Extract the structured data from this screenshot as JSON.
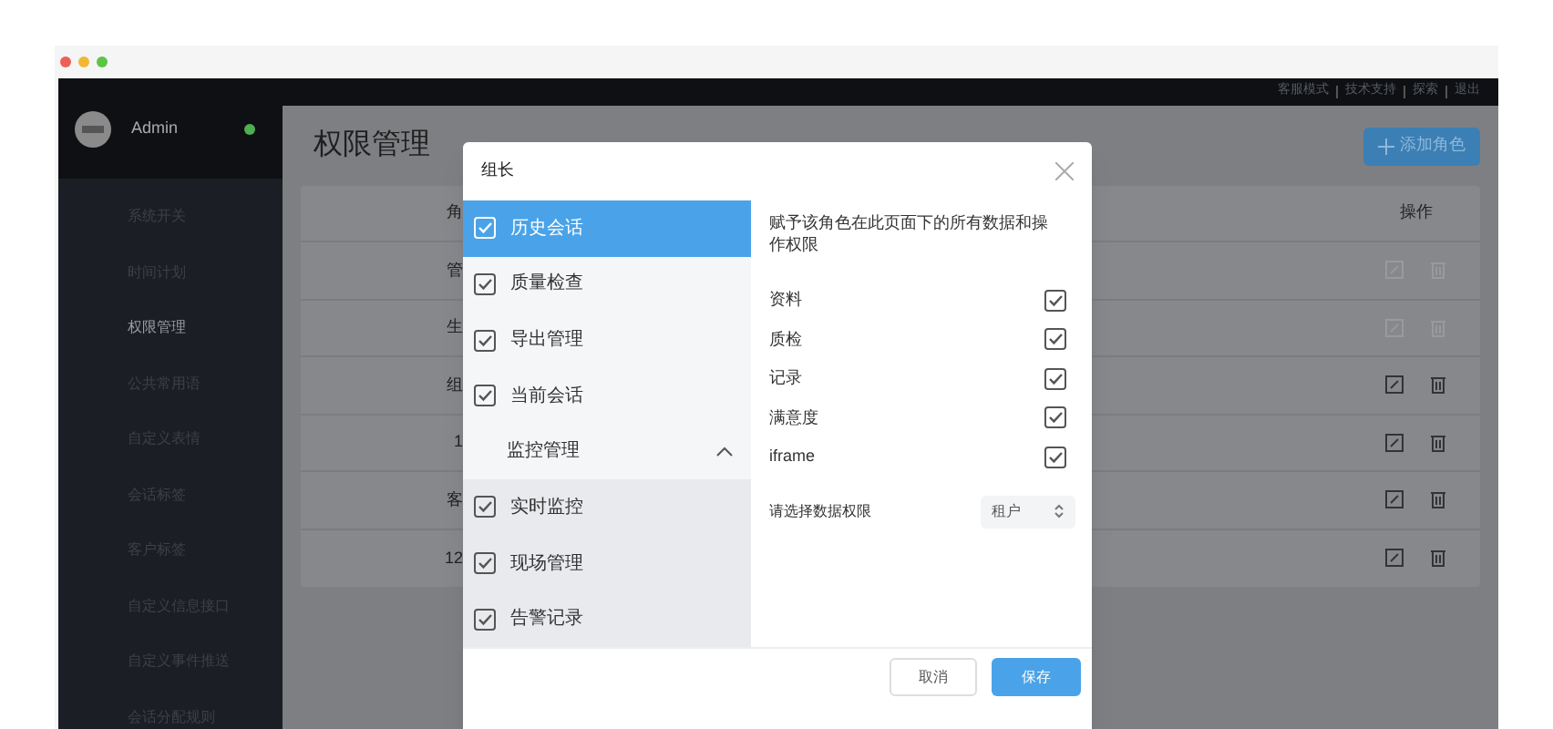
{
  "user": {
    "name": "Admin",
    "online": true
  },
  "top_links": [
    "客服模式",
    "技术支持",
    "探索",
    "退出"
  ],
  "sidebar": {
    "items": [
      {
        "label": "系统开关",
        "selected": false
      },
      {
        "label": "时间计划",
        "selected": false
      },
      {
        "label": "权限管理",
        "selected": true
      },
      {
        "label": "公共常用语",
        "selected": false
      },
      {
        "label": "自定义表情",
        "selected": false
      },
      {
        "label": "会话标签",
        "selected": false
      },
      {
        "label": "客户标签",
        "selected": false
      },
      {
        "label": "自定义信息接口",
        "selected": false
      },
      {
        "label": "自定义事件推送",
        "selected": false
      },
      {
        "label": "会话分配规则",
        "selected": false
      }
    ]
  },
  "page": {
    "title": "权限管理",
    "add_button": "添加角色"
  },
  "table": {
    "column_1": "角",
    "actions_header": "操作",
    "rows": [
      {
        "column_1": "管",
        "disabled": true
      },
      {
        "column_1": "生",
        "disabled": true
      },
      {
        "column_1": "组",
        "disabled": false
      },
      {
        "column_1": "1",
        "disabled": false
      },
      {
        "column_1": "客",
        "disabled": false
      },
      {
        "column_1": "12",
        "disabled": false
      }
    ]
  },
  "dialog": {
    "title": "组长",
    "pages": [
      {
        "kind": "item",
        "label": "历史会话",
        "checked": true,
        "selected": true
      },
      {
        "kind": "item",
        "label": "质量检查",
        "checked": true,
        "selected": false
      },
      {
        "kind": "item",
        "label": "导出管理",
        "checked": true,
        "selected": false
      },
      {
        "kind": "item",
        "label": "当前会话",
        "checked": true,
        "selected": false
      },
      {
        "kind": "group",
        "label": "监控管理",
        "expanded": true,
        "children": [
          {
            "kind": "item",
            "label": "实时监控",
            "checked": true,
            "selected": false
          },
          {
            "kind": "item",
            "label": "现场管理",
            "checked": true,
            "selected": false
          },
          {
            "kind": "item",
            "label": "告警记录",
            "checked": true,
            "selected": false
          }
        ]
      }
    ],
    "description": "赋予该角色在此页面下的所有数据和操作权限",
    "permissions": [
      {
        "label": "资料",
        "checked": true
      },
      {
        "label": "质检",
        "checked": true
      },
      {
        "label": "记录",
        "checked": true
      },
      {
        "label": "满意度",
        "checked": true
      },
      {
        "label": "iframe",
        "checked": true
      }
    ],
    "scope": {
      "label": "请选择数据权限",
      "value": "租户"
    },
    "buttons": {
      "cancel": "取消",
      "save": "保存"
    }
  }
}
